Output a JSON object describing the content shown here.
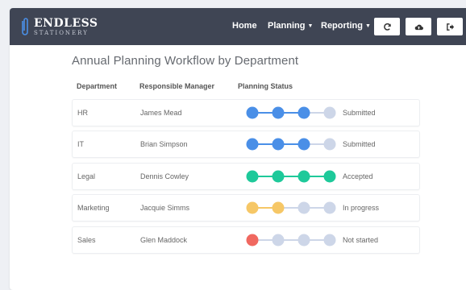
{
  "navbar": {
    "logo_main": "ENDLESS",
    "logo_sub": "STATIONERY",
    "links": [
      {
        "label": "Home",
        "has_caret": false
      },
      {
        "label": "Planning",
        "has_caret": true
      },
      {
        "label": "Reporting",
        "has_caret": true
      }
    ],
    "buttons": [
      "refresh-icon",
      "cloud-upload-icon",
      "sign-out-icon"
    ]
  },
  "main": {
    "title": "Annual Planning Workflow by Department",
    "columns": [
      "Department",
      "Responsible Manager",
      "Planning Status"
    ],
    "rows": [
      {
        "department": "HR",
        "manager": "James Mead",
        "status": "Submitted",
        "steps": [
          "blue",
          "blue",
          "blue",
          "pending"
        ]
      },
      {
        "department": "IT",
        "manager": "Brian Simpson",
        "status": "Submitted",
        "steps": [
          "blue",
          "blue",
          "blue",
          "pending"
        ]
      },
      {
        "department": "Legal",
        "manager": "Dennis Cowley",
        "status": "Accepted",
        "steps": [
          "green",
          "green",
          "green",
          "green"
        ]
      },
      {
        "department": "Marketing",
        "manager": "Jacquie Simms",
        "status": "In progress",
        "steps": [
          "yellow",
          "yellow",
          "pending",
          "pending"
        ]
      },
      {
        "department": "Sales",
        "manager": "Glen Maddock",
        "status": "Not started",
        "steps": [
          "red",
          "pending",
          "pending",
          "pending"
        ]
      }
    ]
  },
  "colors": {
    "navbar": "#3f4554",
    "blue": "#4a8fe7",
    "green": "#1ec99a",
    "yellow": "#f6c766",
    "red": "#f06860",
    "pending": "#cdd6e8"
  }
}
